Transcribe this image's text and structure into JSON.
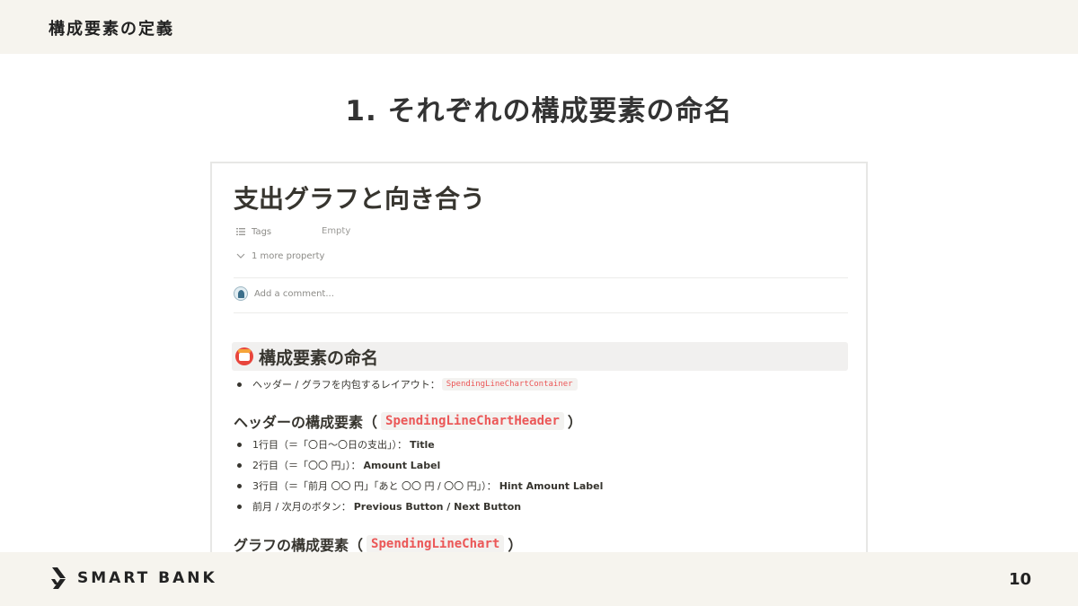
{
  "header": {
    "section_title": "構成要素の定義"
  },
  "slide": {
    "title": "1. それぞれの構成要素の命名",
    "page_number": "10"
  },
  "footer": {
    "logo_text": "SMART BANK"
  },
  "doc": {
    "title": "支出グラフと向き合う",
    "properties": {
      "tags_label": "Tags",
      "tags_value": "Empty",
      "more_label": "1 more property"
    },
    "comment_placeholder": "Add a comment...",
    "heading": "構成要素の命名",
    "layout_bullet": {
      "text": "ヘッダー / グラフを内包するレイアウト：",
      "code": "SpendingLineChartContainer"
    },
    "header_section": {
      "label": "ヘッダーの構成要素",
      "open": "（",
      "code": "SpendingLineChartHeader",
      "close": "）",
      "items": [
        {
          "text": "1行目（＝「〇日〜〇日の支出」）：",
          "bold": "Title"
        },
        {
          "text": "2行目（＝「〇〇 円」）：",
          "bold": "Amount Label"
        },
        {
          "text": "3行目（＝「前月 〇〇 円」「あと 〇〇 円 / 〇〇 円」）：",
          "bold": "Hint Amount Label"
        },
        {
          "text": "前月 / 次月のボタン：",
          "bold": "Previous Button / Next Button"
        }
      ]
    },
    "graph_section": {
      "label": "グラフの構成要素",
      "open": "（",
      "code": "SpendingLineChart",
      "close": "）"
    }
  }
}
